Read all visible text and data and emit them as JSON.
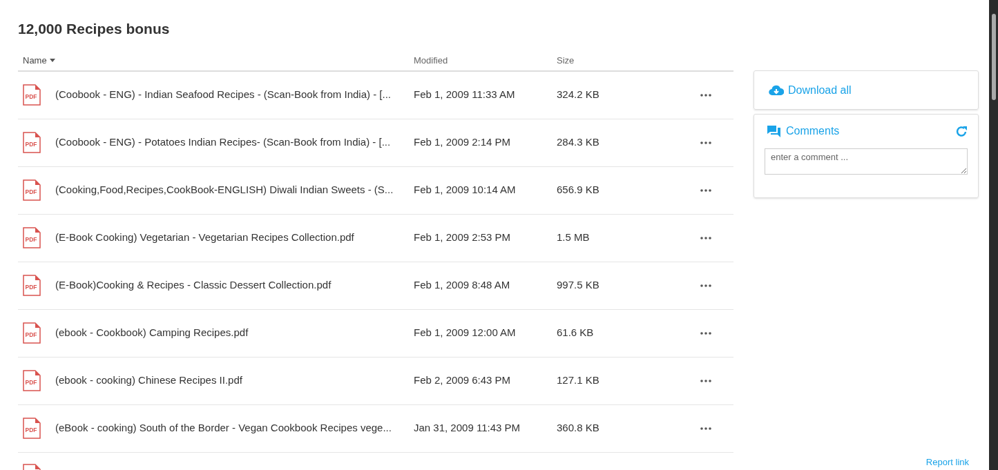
{
  "title": "12,000 Recipes bonus",
  "table": {
    "columns": [
      {
        "label": "Name",
        "sorted": true
      },
      {
        "label": "Modified",
        "sorted": false
      },
      {
        "label": "Size",
        "sorted": false
      }
    ],
    "rows": [
      {
        "type": "PDF",
        "name": "(Coobook - ENG) - Indian Seafood Recipes - (Scan-Book from India) - [...",
        "modified": "Feb 1, 2009 11:33 AM",
        "size": "324.2 KB"
      },
      {
        "type": "PDF",
        "name": "(Coobook - ENG) - Potatoes Indian Recipes- (Scan-Book from India) - [...",
        "modified": "Feb 1, 2009 2:14 PM",
        "size": "284.3 KB"
      },
      {
        "type": "PDF",
        "name": "(Cooking,Food,Recipes,CookBook-ENGLISH) Diwali Indian Sweets - (S...",
        "modified": "Feb 1, 2009 10:14 AM",
        "size": "656.9 KB"
      },
      {
        "type": "PDF",
        "name": "(E-Book Cooking) Vegetarian - Vegetarian Recipes Collection.pdf",
        "modified": "Feb 1, 2009 2:53 PM",
        "size": "1.5 MB"
      },
      {
        "type": "PDF",
        "name": "(E-Book)Cooking & Recipes - Classic Dessert Collection.pdf",
        "modified": "Feb 1, 2009 8:48 AM",
        "size": "997.5 KB"
      },
      {
        "type": "PDF",
        "name": "(ebook - Cookbook) Camping Recipes.pdf",
        "modified": "Feb 1, 2009 12:00 AM",
        "size": "61.6 KB"
      },
      {
        "type": "PDF",
        "name": "(ebook - cooking) Chinese Recipes II.pdf",
        "modified": "Feb 2, 2009 6:43 PM",
        "size": "127.1 KB"
      },
      {
        "type": "PDF",
        "name": "(eBook - cooking) South of the Border - Vegan Cookbook Recipes vege...",
        "modified": "Jan 31, 2009 11:43 PM",
        "size": "360.8 KB"
      }
    ]
  },
  "download": {
    "label": "Download all"
  },
  "comments": {
    "title": "Comments",
    "placeholder": "enter a comment ..."
  },
  "report_link": "Report link"
}
